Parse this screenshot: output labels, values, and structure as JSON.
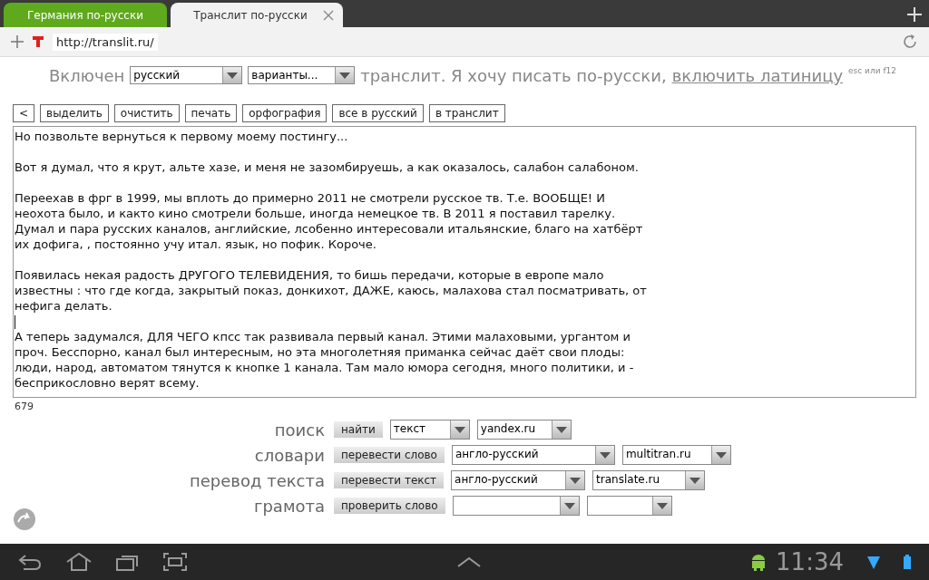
{
  "browser": {
    "tabs": [
      {
        "label": "Германия по-русски",
        "selected": false
      },
      {
        "label": "Транслит по-русски",
        "selected": true
      }
    ],
    "url": "http://translit.ru/"
  },
  "mode_bar": {
    "prefix": "Включен",
    "selects": [
      "русский",
      "варианты..."
    ],
    "text": "транслит. Я хочу писать по-русски,",
    "link": "включить латиницу",
    "hint": "esc или f12"
  },
  "buttons": [
    "<",
    "выделить",
    "очистить",
    "печать",
    "орфография",
    "все в русский",
    "в транслит"
  ],
  "editor": {
    "blocks": [
      {
        "kind": "text",
        "lines": [
          "Но позвольте вернуться к первому моему постингу..."
        ]
      },
      {
        "kind": "gap"
      },
      {
        "kind": "text",
        "lines": [
          "Вот я думал, что я крут, альте хазе, и меня не зазомбируешь, а как оказалось, салабон салабоном."
        ]
      },
      {
        "kind": "gap"
      },
      {
        "kind": "text",
        "lines": [
          "Переехав в фрг в 1999, мы вплоть до примерно 2011 не смотрели русское тв. Т.е. ВООБЩЕ! И",
          "неохота было, и както кино смотрели больше, иногда немецкое тв. В 2011 я поставил тарелку.",
          "Думал и пара русских каналов, английские, лсобенно интересовали итальянские, благо на хатбёрт",
          "их дофига, , постоянно учу итал. язык, но пофик. Короче."
        ]
      },
      {
        "kind": "gap"
      },
      {
        "kind": "text",
        "lines": [
          "Появилась некая радость ДРУГОГО ТЕЛЕВИДЕНИЯ, то бишь передачи, которые в европе мало",
          "известны : что где когда, закрытый показ, донкихот, ДАЖЕ, каюсь, малахова стал посматривать, от",
          "нефига делать."
        ]
      },
      {
        "kind": "caret"
      },
      {
        "kind": "text",
        "lines": [
          "А теперь задумался, ДЛЯ ЧЕГО кпсс так развивала первый канал. Этими малаховыми, ургантом и",
          "проч. Бесспорно, канал был интересным, но эта многолетняя приманка сейчас даёт свои плоды:",
          "люди, народ, автоматом тянутся к кнопке 1 канала. Там мало юмора сегодня, много политики, и -",
          "бесприкословно верят всему."
        ]
      }
    ],
    "counter": "679"
  },
  "services": [
    {
      "label": "поиск",
      "button": "найти",
      "selects": [
        {
          "kind": "select",
          "value": "текст"
        },
        {
          "kind": "select",
          "value": "yandex.ru"
        }
      ]
    },
    {
      "label": "словари",
      "button": "перевести слово",
      "selects": [
        {
          "kind": "select",
          "value": "англо-русский"
        },
        {
          "kind": "select",
          "value": "multitran.ru"
        }
      ]
    },
    {
      "label": "перевод текста",
      "button": "перевести текст",
      "selects": [
        {
          "kind": "select",
          "value": "англо-русский"
        },
        {
          "kind": "select",
          "value": "translate.ru"
        }
      ]
    },
    {
      "label": "грамота",
      "button": "проверить слово",
      "selects": [
        {
          "kind": "select"
        },
        {
          "kind": "select"
        }
      ]
    }
  ],
  "status_bar": {
    "time": "11:34"
  }
}
